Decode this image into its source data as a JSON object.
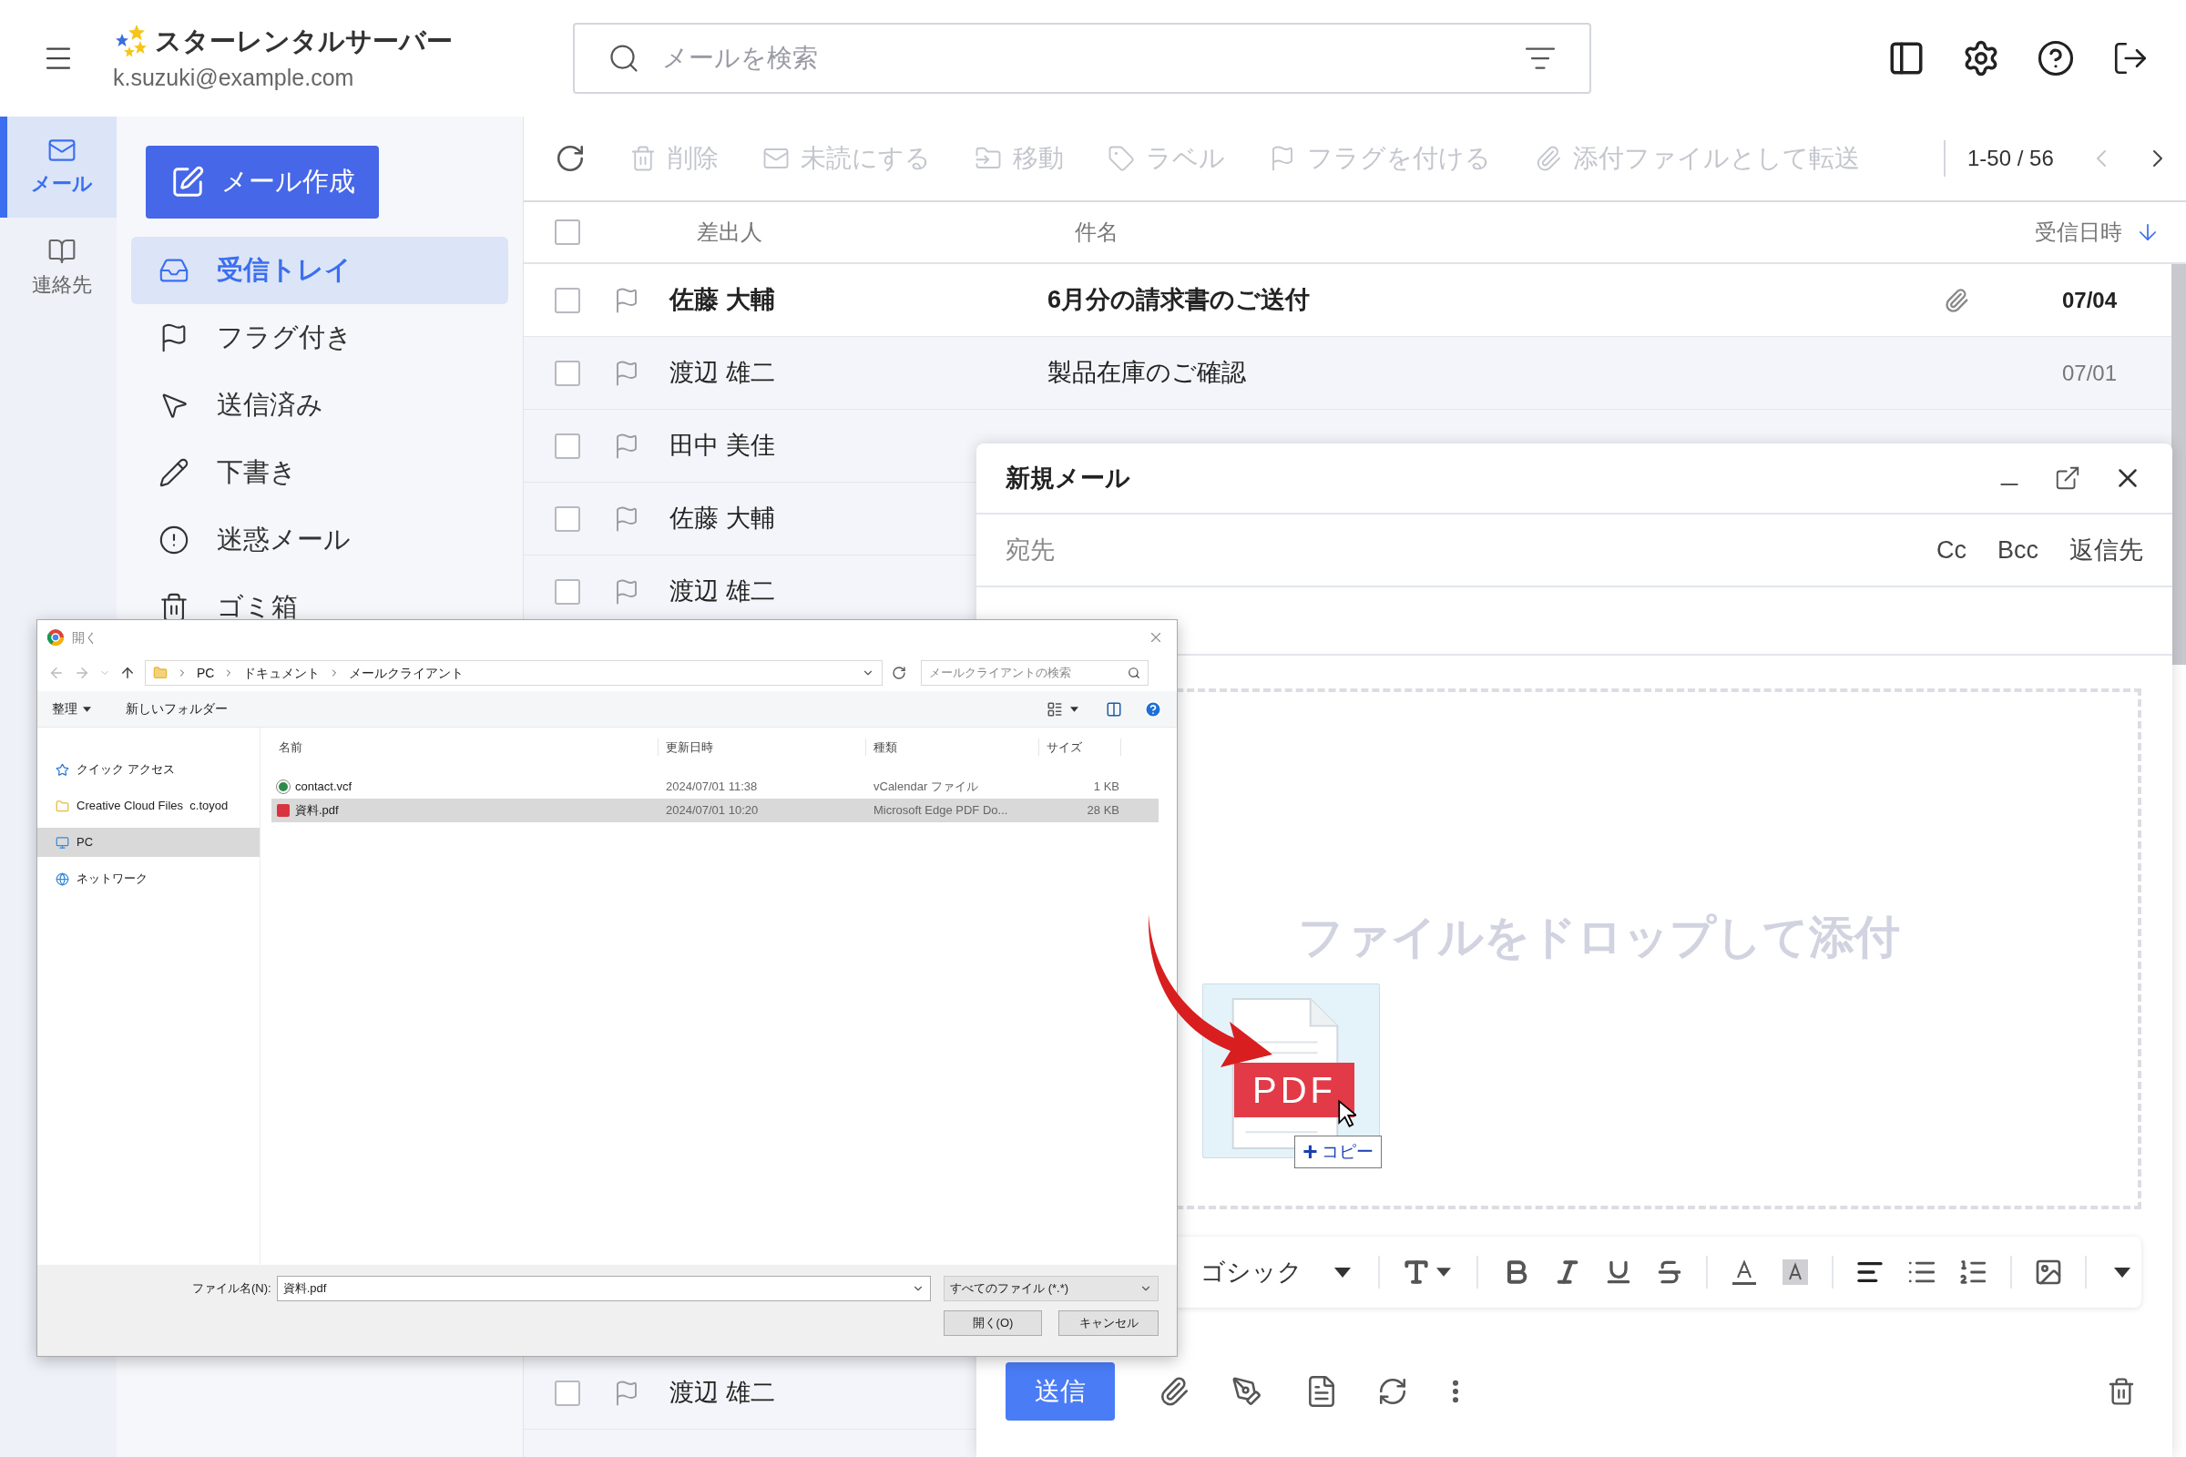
{
  "app": {
    "title": "スターレンタルサーバー",
    "account": "k.suzuki@example.com"
  },
  "search": {
    "placeholder": "メールを検索"
  },
  "rail": [
    {
      "label": "メール",
      "selected": true
    },
    {
      "label": "連絡先",
      "selected": false
    }
  ],
  "compose_button": "メール作成",
  "folders": [
    {
      "label": "受信トレイ",
      "selected": true
    },
    {
      "label": "フラグ付き",
      "selected": false
    },
    {
      "label": "送信済み",
      "selected": false
    },
    {
      "label": "下書き",
      "selected": false
    },
    {
      "label": "迷惑メール",
      "selected": false
    },
    {
      "label": "ゴミ箱",
      "selected": false
    }
  ],
  "toolbar": {
    "actions": [
      {
        "label": "削除",
        "disabled": true
      },
      {
        "label": "未読にする",
        "disabled": true
      },
      {
        "label": "移動",
        "disabled": true
      },
      {
        "label": "ラベル",
        "disabled": true
      },
      {
        "label": "フラグを付ける",
        "disabled": true
      },
      {
        "label": "添付ファイルとして転送",
        "disabled": true
      }
    ],
    "range": "1-50 / 56"
  },
  "columns": {
    "select_all_checked": false,
    "sender": "差出人",
    "subject": "件名",
    "date": "受信日時"
  },
  "rows_top": [
    {
      "sender": "佐藤 大輔",
      "subject": "6月分の請求書のご送付",
      "date": "07/04",
      "unread": true,
      "attachment": true,
      "checked": false
    },
    {
      "sender": "渡辺 雄二",
      "subject": "製品在庫のご確認",
      "date": "07/01",
      "unread": false,
      "checked": false
    },
    {
      "sender": "田中 美佳",
      "unread": false,
      "checked": false
    },
    {
      "sender": "佐藤 大輔",
      "unread": false,
      "checked": false
    },
    {
      "sender": "渡辺 雄二",
      "unread": false,
      "checked": false
    }
  ],
  "rows_bottom": [
    {
      "sender": "渡辺 雄二",
      "unread": false,
      "checked": false
    }
  ],
  "compose": {
    "title": "新規メール",
    "to_label": "宛先",
    "recipient_options": [
      "Cc",
      "Bcc",
      "返信先"
    ],
    "drop_hint": "ファイルをドロップして添付",
    "font": "ゴシック",
    "send": "送信"
  },
  "drag": {
    "file_label": "PDF",
    "plus": "+",
    "effect": "コピー"
  },
  "dialog": {
    "title": "開く",
    "path": [
      "PC",
      "ドキュメント",
      "メールクライアント"
    ],
    "search_placeholder": "メールクライアントの検索",
    "organize": "整理",
    "new_folder": "新しいフォルダー",
    "nav": [
      {
        "label": "クイック アクセス",
        "selected": false
      },
      {
        "label": "Creative Cloud Files  c.toyod",
        "selected": false
      },
      {
        "label": "PC",
        "selected": true
      },
      {
        "label": "ネットワーク",
        "selected": false
      }
    ],
    "columns": [
      "名前",
      "更新日時",
      "種類",
      "サイズ"
    ],
    "files": [
      {
        "name": "contact.vcf",
        "modified": "2024/07/01 11:38",
        "type": "vCalendar ファイル",
        "size": "1 KB",
        "kind": "vcf",
        "selected": false
      },
      {
        "name": "資料.pdf",
        "modified": "2024/07/01 10:20",
        "type": "Microsoft Edge PDF Do...",
        "size": "28 KB",
        "kind": "pdf",
        "selected": true
      }
    ],
    "filename_label": "ファイル名(N):",
    "filename": "資料.pdf",
    "filter": "すべてのファイル (*.*)",
    "open": "開く(O)",
    "cancel": "キャンセル"
  }
}
